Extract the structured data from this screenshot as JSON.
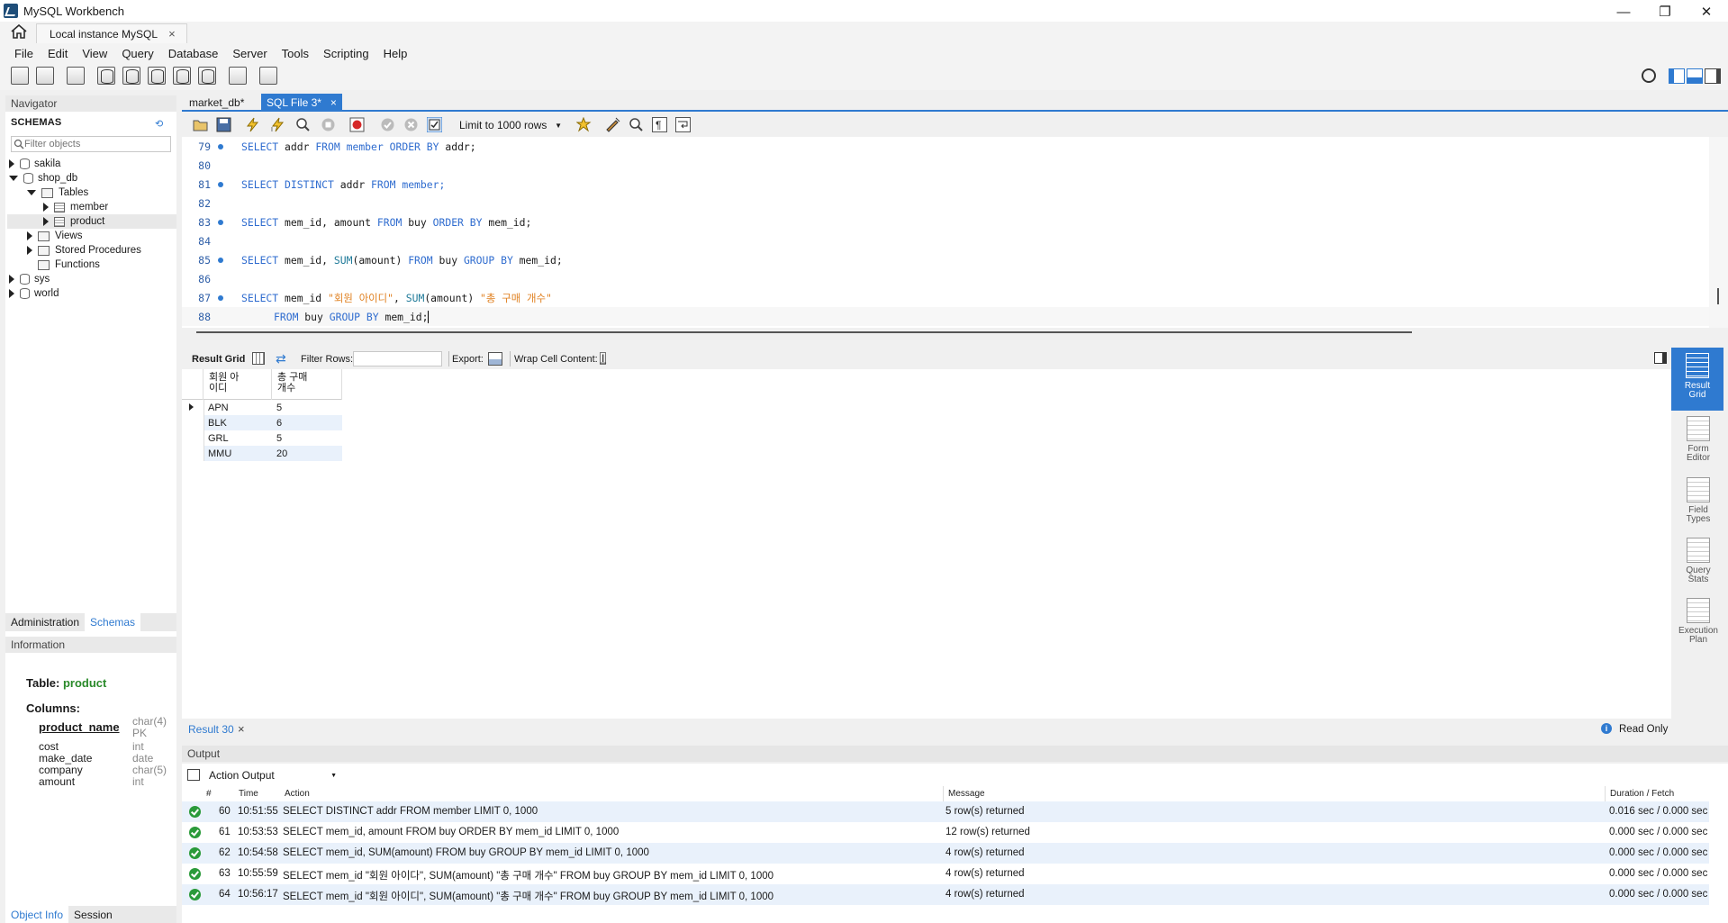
{
  "window": {
    "title": "MySQL Workbench",
    "minimize_glyph": "—",
    "restore_glyph": "❐",
    "close_glyph": "✕"
  },
  "connection_tab": {
    "label": "Local instance MySQL",
    "close": "×"
  },
  "menu": [
    "File",
    "Edit",
    "View",
    "Query",
    "Database",
    "Server",
    "Tools",
    "Scripting",
    "Help"
  ],
  "navigator": {
    "header": "Navigator",
    "schemas_title": "SCHEMAS",
    "filter_placeholder": "Filter objects",
    "tree": {
      "sakila": "sakila",
      "shop_db": "shop_db",
      "tables": "Tables",
      "member": "member",
      "product": "product",
      "views": "Views",
      "procedures": "Stored Procedures",
      "functions": "Functions",
      "sys": "sys",
      "world": "world"
    },
    "tab_admin": "Administration",
    "tab_schemas": "Schemas"
  },
  "information": {
    "header": "Information",
    "table_label": "Table:",
    "table_name": "product",
    "columns_label": "Columns:",
    "columns": [
      {
        "name": "product_name",
        "type": "char(4)",
        "extra": "PK"
      },
      {
        "name": "cost",
        "type": "int"
      },
      {
        "name": "make_date",
        "type": "date"
      },
      {
        "name": "company",
        "type": "char(5)"
      },
      {
        "name": "amount",
        "type": "int"
      }
    ]
  },
  "bottom_tabs": {
    "object_info": "Object Info",
    "session": "Session"
  },
  "editor_tabs": {
    "tab1": "market_db*",
    "tab2": "SQL File 3*",
    "close": "×"
  },
  "sql_toolbar": {
    "limit": "Limit to 1000 rows"
  },
  "code": {
    "ln79": "79",
    "ln80": "80",
    "ln81": "81",
    "ln82": "82",
    "ln83": "83",
    "ln84": "84",
    "ln85": "85",
    "ln86": "86",
    "ln87": "87",
    "ln88": "88",
    "select": "SELECT",
    "distinct": "DISTINCT",
    "from": "FROM",
    "order_by": "ORDER BY",
    "group_by": "GROUP BY",
    "sum": "SUM",
    "l79_a": "addr",
    "l79_tbl": "member",
    "l79_b": "addr;",
    "l81_a": "addr",
    "l81_tbl": "member;",
    "l83_a": "mem_id, amount",
    "l83_b": "buy",
    "l83_c": "mem_id;",
    "l85_a": "mem_id,",
    "l85_b": "(amount)",
    "l85_c": "buy",
    "l85_d": "mem_id;",
    "l87_a": "mem_id",
    "l87_alias1": "\"회원 아이디\"",
    "l87_b": ",",
    "l87_c": "(amount)",
    "l87_alias2": "\"총 구매 개수\"",
    "l88_a": "buy",
    "l88_b": "mem_id;"
  },
  "result_toolbar": {
    "result_grid": "Result Grid",
    "filter_rows": "Filter Rows:",
    "export": "Export:",
    "wrap": "Wrap Cell Content:"
  },
  "result_grid": {
    "col1": "회원 아\n이디",
    "col2": "총 구매\n개수",
    "rows": [
      {
        "id": "APN",
        "cnt": "5"
      },
      {
        "id": "BLK",
        "cnt": "6"
      },
      {
        "id": "GRL",
        "cnt": "5"
      },
      {
        "id": "MMU",
        "cnt": "20"
      }
    ]
  },
  "right_panel": {
    "result_grid": "Result\nGrid",
    "form_editor": "Form\nEditor",
    "field_types": "Field\nTypes",
    "query_stats": "Query\nStats",
    "execution_plan": "Execution\nPlan"
  },
  "result_tab": {
    "label": "Result 30",
    "close": "×",
    "read_only": "Read Only"
  },
  "output": {
    "header": "Output",
    "selector": "Action Output",
    "columns": {
      "num": "#",
      "time": "Time",
      "action": "Action",
      "message": "Message",
      "duration": "Duration / Fetch"
    },
    "rows": [
      {
        "num": "60",
        "time": "10:51:55",
        "action": "SELECT DISTINCT addr FROM member LIMIT 0, 1000",
        "message": "5 row(s) returned",
        "duration": "0.016 sec / 0.000 sec"
      },
      {
        "num": "61",
        "time": "10:53:53",
        "action": "SELECT mem_id, amount FROM buy ORDER BY mem_id LIMIT 0, 1000",
        "message": "12 row(s) returned",
        "duration": "0.000 sec / 0.000 sec"
      },
      {
        "num": "62",
        "time": "10:54:58",
        "action": "SELECT mem_id, SUM(amount) FROM buy GROUP BY mem_id LIMIT 0, 1000",
        "message": "4 row(s) returned",
        "duration": "0.000 sec / 0.000 sec"
      },
      {
        "num": "63",
        "time": "10:55:59",
        "action": "SELECT mem_id \"회원 아이다\", SUM(amount) \"총 구매 개수\"  FROM buy GROUP BY mem_id LIMIT 0, 1000",
        "message": "4 row(s) returned",
        "duration": "0.000 sec / 0.000 sec"
      },
      {
        "num": "64",
        "time": "10:56:17",
        "action": "SELECT mem_id \"회원 아이디\", SUM(amount) \"총 구매 개수\"  FROM buy GROUP BY mem_id LIMIT 0, 1000",
        "message": "4 row(s) returned",
        "duration": "0.000 sec / 0.000 sec"
      }
    ]
  },
  "colors": {
    "accent": "#2f7ad0",
    "keyword": "#2f6ccf",
    "string": "#e08020",
    "ok": "#2a9a3a"
  }
}
